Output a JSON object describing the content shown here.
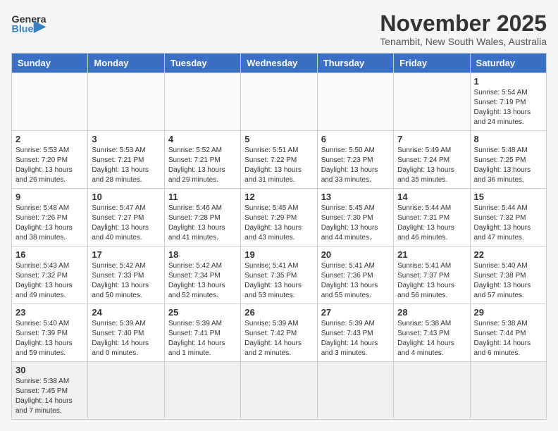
{
  "header": {
    "logo_general": "General",
    "logo_blue": "Blue",
    "month_title": "November 2025",
    "location": "Tenambit, New South Wales, Australia"
  },
  "days_of_week": [
    "Sunday",
    "Monday",
    "Tuesday",
    "Wednesday",
    "Thursday",
    "Friday",
    "Saturday"
  ],
  "weeks": [
    [
      {
        "day": "",
        "info": ""
      },
      {
        "day": "",
        "info": ""
      },
      {
        "day": "",
        "info": ""
      },
      {
        "day": "",
        "info": ""
      },
      {
        "day": "",
        "info": ""
      },
      {
        "day": "",
        "info": ""
      },
      {
        "day": "1",
        "info": "Sunrise: 5:54 AM\nSunset: 7:19 PM\nDaylight: 13 hours\nand 24 minutes."
      }
    ],
    [
      {
        "day": "2",
        "info": "Sunrise: 5:53 AM\nSunset: 7:20 PM\nDaylight: 13 hours\nand 26 minutes."
      },
      {
        "day": "3",
        "info": "Sunrise: 5:53 AM\nSunset: 7:21 PM\nDaylight: 13 hours\nand 28 minutes."
      },
      {
        "day": "4",
        "info": "Sunrise: 5:52 AM\nSunset: 7:21 PM\nDaylight: 13 hours\nand 29 minutes."
      },
      {
        "day": "5",
        "info": "Sunrise: 5:51 AM\nSunset: 7:22 PM\nDaylight: 13 hours\nand 31 minutes."
      },
      {
        "day": "6",
        "info": "Sunrise: 5:50 AM\nSunset: 7:23 PM\nDaylight: 13 hours\nand 33 minutes."
      },
      {
        "day": "7",
        "info": "Sunrise: 5:49 AM\nSunset: 7:24 PM\nDaylight: 13 hours\nand 35 minutes."
      },
      {
        "day": "8",
        "info": "Sunrise: 5:48 AM\nSunset: 7:25 PM\nDaylight: 13 hours\nand 36 minutes."
      }
    ],
    [
      {
        "day": "9",
        "info": "Sunrise: 5:48 AM\nSunset: 7:26 PM\nDaylight: 13 hours\nand 38 minutes."
      },
      {
        "day": "10",
        "info": "Sunrise: 5:47 AM\nSunset: 7:27 PM\nDaylight: 13 hours\nand 40 minutes."
      },
      {
        "day": "11",
        "info": "Sunrise: 5:46 AM\nSunset: 7:28 PM\nDaylight: 13 hours\nand 41 minutes."
      },
      {
        "day": "12",
        "info": "Sunrise: 5:45 AM\nSunset: 7:29 PM\nDaylight: 13 hours\nand 43 minutes."
      },
      {
        "day": "13",
        "info": "Sunrise: 5:45 AM\nSunset: 7:30 PM\nDaylight: 13 hours\nand 44 minutes."
      },
      {
        "day": "14",
        "info": "Sunrise: 5:44 AM\nSunset: 7:31 PM\nDaylight: 13 hours\nand 46 minutes."
      },
      {
        "day": "15",
        "info": "Sunrise: 5:44 AM\nSunset: 7:32 PM\nDaylight: 13 hours\nand 47 minutes."
      }
    ],
    [
      {
        "day": "16",
        "info": "Sunrise: 5:43 AM\nSunset: 7:32 PM\nDaylight: 13 hours\nand 49 minutes."
      },
      {
        "day": "17",
        "info": "Sunrise: 5:42 AM\nSunset: 7:33 PM\nDaylight: 13 hours\nand 50 minutes."
      },
      {
        "day": "18",
        "info": "Sunrise: 5:42 AM\nSunset: 7:34 PM\nDaylight: 13 hours\nand 52 minutes."
      },
      {
        "day": "19",
        "info": "Sunrise: 5:41 AM\nSunset: 7:35 PM\nDaylight: 13 hours\nand 53 minutes."
      },
      {
        "day": "20",
        "info": "Sunrise: 5:41 AM\nSunset: 7:36 PM\nDaylight: 13 hours\nand 55 minutes."
      },
      {
        "day": "21",
        "info": "Sunrise: 5:41 AM\nSunset: 7:37 PM\nDaylight: 13 hours\nand 56 minutes."
      },
      {
        "day": "22",
        "info": "Sunrise: 5:40 AM\nSunset: 7:38 PM\nDaylight: 13 hours\nand 57 minutes."
      }
    ],
    [
      {
        "day": "23",
        "info": "Sunrise: 5:40 AM\nSunset: 7:39 PM\nDaylight: 13 hours\nand 59 minutes."
      },
      {
        "day": "24",
        "info": "Sunrise: 5:39 AM\nSunset: 7:40 PM\nDaylight: 14 hours\nand 0 minutes."
      },
      {
        "day": "25",
        "info": "Sunrise: 5:39 AM\nSunset: 7:41 PM\nDaylight: 14 hours\nand 1 minute."
      },
      {
        "day": "26",
        "info": "Sunrise: 5:39 AM\nSunset: 7:42 PM\nDaylight: 14 hours\nand 2 minutes."
      },
      {
        "day": "27",
        "info": "Sunrise: 5:39 AM\nSunset: 7:43 PM\nDaylight: 14 hours\nand 3 minutes."
      },
      {
        "day": "28",
        "info": "Sunrise: 5:38 AM\nSunset: 7:43 PM\nDaylight: 14 hours\nand 4 minutes."
      },
      {
        "day": "29",
        "info": "Sunrise: 5:38 AM\nSunset: 7:44 PM\nDaylight: 14 hours\nand 6 minutes."
      }
    ],
    [
      {
        "day": "30",
        "info": "Sunrise: 5:38 AM\nSunset: 7:45 PM\nDaylight: 14 hours\nand 7 minutes."
      },
      {
        "day": "",
        "info": ""
      },
      {
        "day": "",
        "info": ""
      },
      {
        "day": "",
        "info": ""
      },
      {
        "day": "",
        "info": ""
      },
      {
        "day": "",
        "info": ""
      },
      {
        "day": "",
        "info": ""
      }
    ]
  ]
}
